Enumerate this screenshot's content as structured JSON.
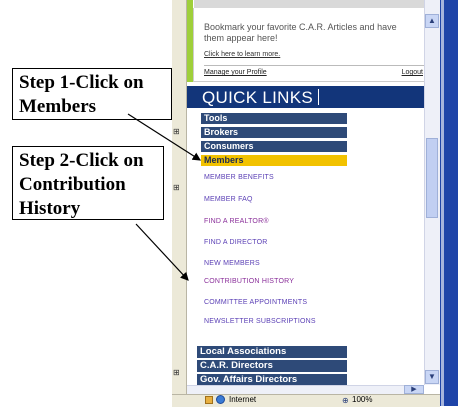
{
  "callouts": {
    "step1": [
      "Step 1-Click on",
      "Members"
    ],
    "step2": [
      "Step 2-Click on",
      "Contribution",
      "History"
    ]
  },
  "bookmark": {
    "text": "Bookmark your favorite C.A.R. Articles and have them appear here!",
    "learn_more": "Click here to learn more.",
    "manage_profile": "Manage your Profile",
    "logout": "Logout"
  },
  "quick_links": {
    "title": "QUICK LINKS",
    "menus": [
      "Tools",
      "Brokers",
      "Consumers"
    ],
    "selected": "Members",
    "sub_links": [
      "MEMBER BENEFITS",
      "MEMBER FAQ",
      "FIND A REALTOR®",
      "FIND A DIRECTOR",
      "NEW MEMBERS",
      "CONTRIBUTION HISTORY",
      "COMMITTEE APPOINTMENTS",
      "NEWSLETTER SUBSCRIPTIONS"
    ],
    "bottom_menus": [
      "Local Associations",
      "C.A.R. Directors",
      "Gov. Affairs Directors"
    ]
  },
  "status_bar": {
    "zone": "Internet",
    "zoom": "100%"
  },
  "colors": {
    "quick_links_header": "#12357a",
    "menu_bar": "#2e4a78",
    "selected": "#f2c200",
    "link": "#5a3fb5",
    "visited_link": "#8a2f9a"
  },
  "icons": {
    "scroll_up": "arrow-up-icon",
    "scroll_down": "arrow-down-icon",
    "scroll_right": "arrow-right-icon",
    "page": "page-icon",
    "globe": "globe-icon",
    "zoom": "zoom-icon"
  }
}
